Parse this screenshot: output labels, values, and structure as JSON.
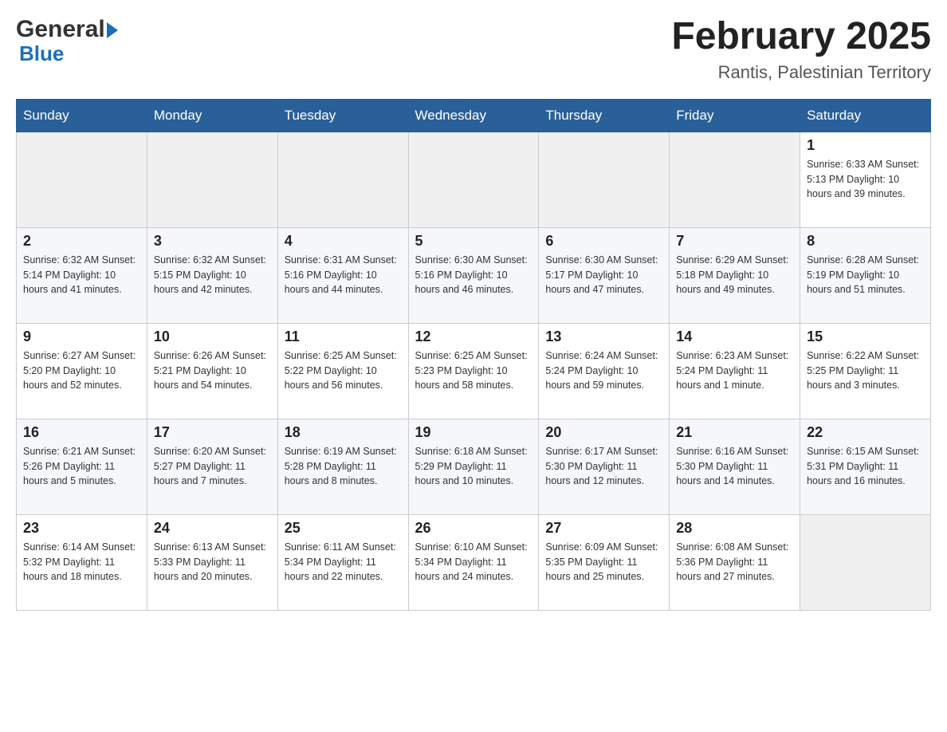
{
  "header": {
    "logo_general": "General",
    "logo_arrow": "▶",
    "logo_blue": "Blue",
    "month_title": "February 2025",
    "location": "Rantis, Palestinian Territory"
  },
  "days_of_week": [
    "Sunday",
    "Monday",
    "Tuesday",
    "Wednesday",
    "Thursday",
    "Friday",
    "Saturday"
  ],
  "weeks": [
    [
      {
        "day": "",
        "info": ""
      },
      {
        "day": "",
        "info": ""
      },
      {
        "day": "",
        "info": ""
      },
      {
        "day": "",
        "info": ""
      },
      {
        "day": "",
        "info": ""
      },
      {
        "day": "",
        "info": ""
      },
      {
        "day": "1",
        "info": "Sunrise: 6:33 AM\nSunset: 5:13 PM\nDaylight: 10 hours and 39 minutes."
      }
    ],
    [
      {
        "day": "2",
        "info": "Sunrise: 6:32 AM\nSunset: 5:14 PM\nDaylight: 10 hours and 41 minutes."
      },
      {
        "day": "3",
        "info": "Sunrise: 6:32 AM\nSunset: 5:15 PM\nDaylight: 10 hours and 42 minutes."
      },
      {
        "day": "4",
        "info": "Sunrise: 6:31 AM\nSunset: 5:16 PM\nDaylight: 10 hours and 44 minutes."
      },
      {
        "day": "5",
        "info": "Sunrise: 6:30 AM\nSunset: 5:16 PM\nDaylight: 10 hours and 46 minutes."
      },
      {
        "day": "6",
        "info": "Sunrise: 6:30 AM\nSunset: 5:17 PM\nDaylight: 10 hours and 47 minutes."
      },
      {
        "day": "7",
        "info": "Sunrise: 6:29 AM\nSunset: 5:18 PM\nDaylight: 10 hours and 49 minutes."
      },
      {
        "day": "8",
        "info": "Sunrise: 6:28 AM\nSunset: 5:19 PM\nDaylight: 10 hours and 51 minutes."
      }
    ],
    [
      {
        "day": "9",
        "info": "Sunrise: 6:27 AM\nSunset: 5:20 PM\nDaylight: 10 hours and 52 minutes."
      },
      {
        "day": "10",
        "info": "Sunrise: 6:26 AM\nSunset: 5:21 PM\nDaylight: 10 hours and 54 minutes."
      },
      {
        "day": "11",
        "info": "Sunrise: 6:25 AM\nSunset: 5:22 PM\nDaylight: 10 hours and 56 minutes."
      },
      {
        "day": "12",
        "info": "Sunrise: 6:25 AM\nSunset: 5:23 PM\nDaylight: 10 hours and 58 minutes."
      },
      {
        "day": "13",
        "info": "Sunrise: 6:24 AM\nSunset: 5:24 PM\nDaylight: 10 hours and 59 minutes."
      },
      {
        "day": "14",
        "info": "Sunrise: 6:23 AM\nSunset: 5:24 PM\nDaylight: 11 hours and 1 minute."
      },
      {
        "day": "15",
        "info": "Sunrise: 6:22 AM\nSunset: 5:25 PM\nDaylight: 11 hours and 3 minutes."
      }
    ],
    [
      {
        "day": "16",
        "info": "Sunrise: 6:21 AM\nSunset: 5:26 PM\nDaylight: 11 hours and 5 minutes."
      },
      {
        "day": "17",
        "info": "Sunrise: 6:20 AM\nSunset: 5:27 PM\nDaylight: 11 hours and 7 minutes."
      },
      {
        "day": "18",
        "info": "Sunrise: 6:19 AM\nSunset: 5:28 PM\nDaylight: 11 hours and 8 minutes."
      },
      {
        "day": "19",
        "info": "Sunrise: 6:18 AM\nSunset: 5:29 PM\nDaylight: 11 hours and 10 minutes."
      },
      {
        "day": "20",
        "info": "Sunrise: 6:17 AM\nSunset: 5:30 PM\nDaylight: 11 hours and 12 minutes."
      },
      {
        "day": "21",
        "info": "Sunrise: 6:16 AM\nSunset: 5:30 PM\nDaylight: 11 hours and 14 minutes."
      },
      {
        "day": "22",
        "info": "Sunrise: 6:15 AM\nSunset: 5:31 PM\nDaylight: 11 hours and 16 minutes."
      }
    ],
    [
      {
        "day": "23",
        "info": "Sunrise: 6:14 AM\nSunset: 5:32 PM\nDaylight: 11 hours and 18 minutes."
      },
      {
        "day": "24",
        "info": "Sunrise: 6:13 AM\nSunset: 5:33 PM\nDaylight: 11 hours and 20 minutes."
      },
      {
        "day": "25",
        "info": "Sunrise: 6:11 AM\nSunset: 5:34 PM\nDaylight: 11 hours and 22 minutes."
      },
      {
        "day": "26",
        "info": "Sunrise: 6:10 AM\nSunset: 5:34 PM\nDaylight: 11 hours and 24 minutes."
      },
      {
        "day": "27",
        "info": "Sunrise: 6:09 AM\nSunset: 5:35 PM\nDaylight: 11 hours and 25 minutes."
      },
      {
        "day": "28",
        "info": "Sunrise: 6:08 AM\nSunset: 5:36 PM\nDaylight: 11 hours and 27 minutes."
      },
      {
        "day": "",
        "info": ""
      }
    ]
  ]
}
